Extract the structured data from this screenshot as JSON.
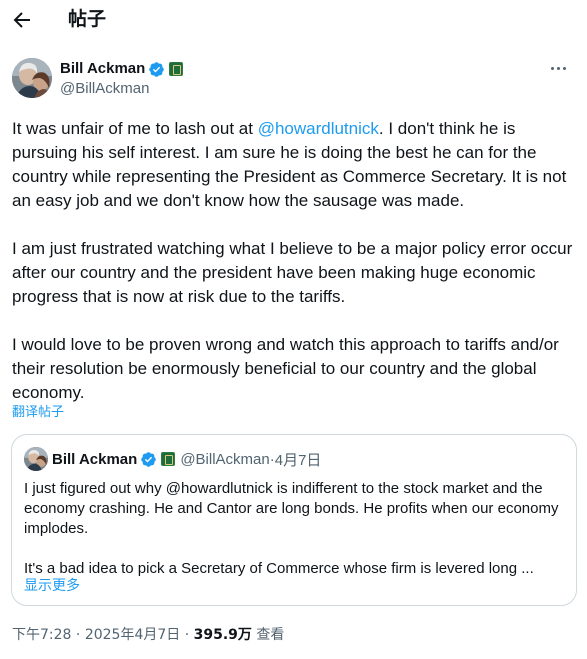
{
  "header": {
    "back_icon": "arrow-left-icon",
    "title": "帖子"
  },
  "author": {
    "name": "Bill Ackman",
    "handle": "@BillAckman",
    "verified_icon": "verified-badge-icon",
    "affiliation_icon": "affiliate-badge-icon",
    "more_icon": "more-horizontal-icon"
  },
  "tweet": {
    "p1_before": "It was unfair of me to lash out at ",
    "p1_mention": "@howardlutnick",
    "p1_after": ". I don't think he is pursuing his self interest. I am sure he is doing the best he can for the country while representing the President as Commerce Secretary. It is not an easy job and we don't know how the sausage was made.",
    "p2": "I am just frustrated watching what I believe to be a major policy error occur after our country and the president have been making huge economic progress that is now at risk due to the tariffs.",
    "p3": "I would love to be proven wrong and watch this approach to tariffs and/or their resolution be enormously beneficial to our country and the global economy."
  },
  "translate_label": "翻译帖子",
  "quote": {
    "name": "Bill Ackman",
    "handle": "@BillAckman",
    "separator": " · ",
    "date": "4月7日",
    "p1": "I just figured out why @howardlutnick is indifferent to the stock market and the economy crashing. He and Cantor are long bonds. He profits when our economy implodes.",
    "p2": "It's a bad idea to pick a Secretary of Commerce whose firm is levered long ...",
    "show_more": "显示更多"
  },
  "meta": {
    "time": "下午7:28",
    "separator": " · ",
    "date": "2025年4月7日",
    "views_count": "395.9万",
    "views_label": " 查看"
  },
  "colors": {
    "accent": "#1d9bf0",
    "text": "#0f1419",
    "secondary": "#536471",
    "border": "#cfd9de"
  }
}
